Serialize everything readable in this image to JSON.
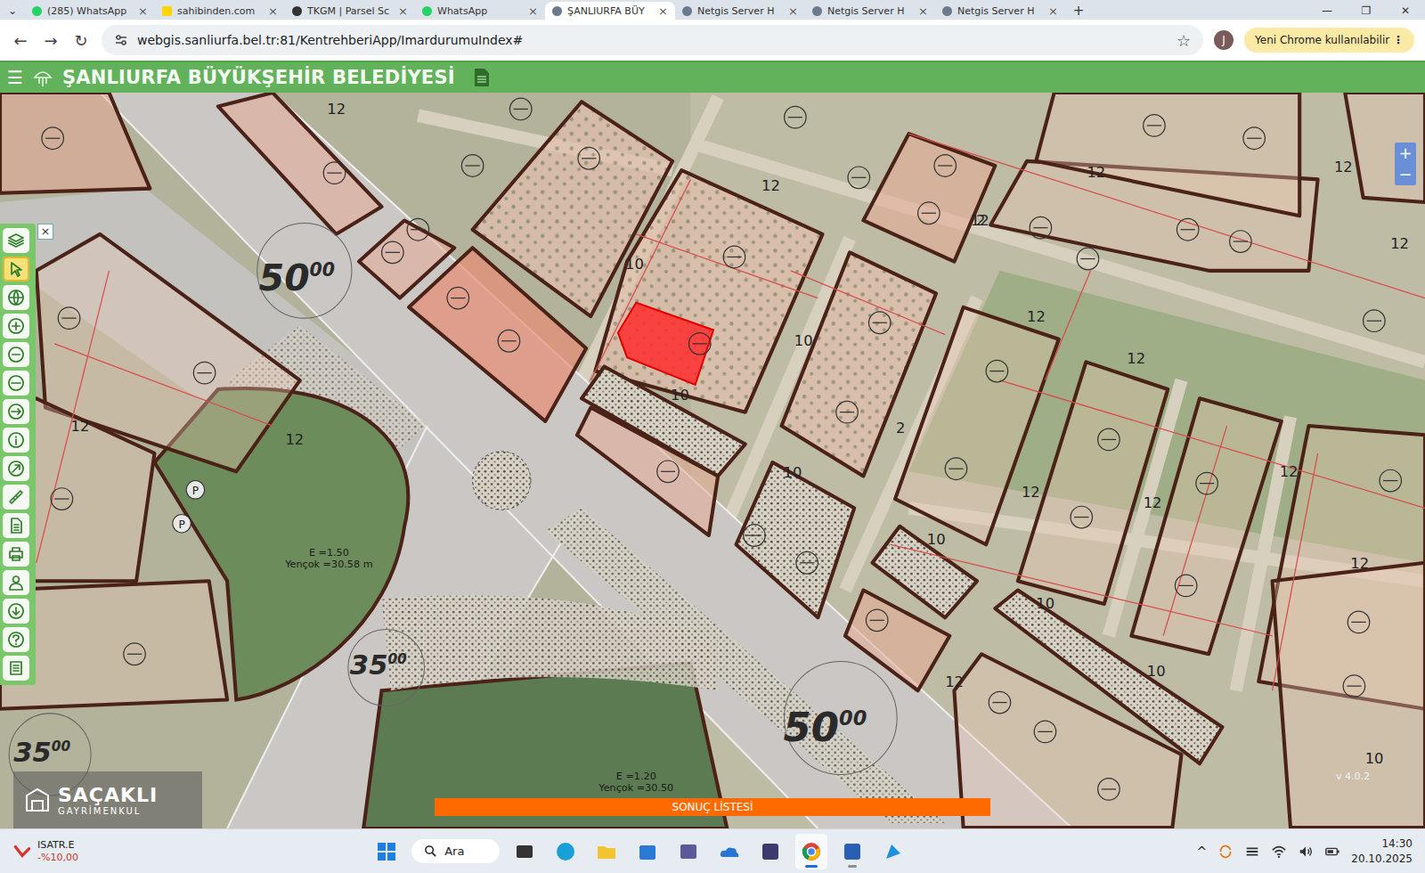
{
  "browser": {
    "tab_search": "⌄",
    "tabs": [
      {
        "label": "(285) WhatsApp",
        "selected": false
      },
      {
        "label": "sahibinden.com",
        "selected": false
      },
      {
        "label": "TKGM | Parsel Sc",
        "selected": false
      },
      {
        "label": "WhatsApp",
        "selected": false
      },
      {
        "label": "ŞANLIURFA BÜY",
        "selected": true
      },
      {
        "label": "Netgis Server H",
        "selected": false
      },
      {
        "label": "Netgis Server H",
        "selected": false
      },
      {
        "label": "Netgis Server H",
        "selected": false
      }
    ],
    "tab_close": "×",
    "new_tab": "+",
    "window_controls": [
      "—",
      "❐",
      "✕"
    ],
    "nav": [
      "←",
      "→",
      "↻"
    ],
    "url": "webgis.sanliurfa.bel.tr:81/KentrehberiApp/ImardurumuIndex#",
    "bookmark": "☆",
    "profile": "J",
    "update_button": "Yeni Chrome kullanılabilir",
    "menu": "⋮"
  },
  "app_header": {
    "menu": "☰",
    "title": "ŞANLIURFA BÜYÜKŞEHİR BELEDİYESİ"
  },
  "toolbar": {
    "close": "×",
    "tools": [
      {
        "selected": false
      },
      {
        "selected": true
      },
      {
        "selected": false
      },
      {
        "selected": false
      },
      {
        "selected": false
      },
      {
        "selected": false
      },
      {
        "selected": false
      },
      {
        "selected": false
      },
      {
        "selected": false
      },
      {
        "selected": false
      },
      {
        "selected": false
      },
      {
        "selected": false
      },
      {
        "selected": false
      },
      {
        "selected": false
      },
      {
        "selected": false
      },
      {
        "selected": false
      }
    ]
  },
  "zoom": [
    "+",
    "−"
  ],
  "map": {
    "selected_parcel": {
      "highlighted": true
    },
    "road_labels": [
      {
        "text": "50",
        "sup": "00"
      },
      {
        "text": "35",
        "sup": "00"
      },
      {
        "text": "50",
        "sup": "00"
      },
      {
        "text": "35",
        "sup": "00"
      }
    ],
    "dimension_labels": [
      "12",
      "12",
      "12",
      "12",
      "12",
      "12",
      "12",
      "12",
      "12",
      "12",
      "12",
      "12",
      "12",
      "12",
      "12",
      "10",
      "10",
      "10",
      "10",
      "10",
      "10",
      "10",
      "10",
      "2",
      "2"
    ],
    "area_notes": [
      [
        "E =1.50",
        "Yençok =30.58 m"
      ],
      [
        "E =1.20",
        "Yençok =30.50"
      ]
    ],
    "parking": [
      "P",
      "P"
    ],
    "version": "v 4.0.2"
  },
  "results_bar": "SONUÇ LİSTESİ",
  "watermark": {
    "name": "SAÇAKLI",
    "sub": "GAYRİMENKUL"
  },
  "taskbar": {
    "stock": {
      "symbol": "ISATR.E",
      "change": "-%10,00"
    },
    "search": "Ara",
    "apps": [
      {
        "running": false,
        "active": false
      },
      {
        "running": false,
        "active": false
      },
      {
        "running": false,
        "active": false
      },
      {
        "running": false,
        "active": false
      },
      {
        "running": false,
        "active": false
      },
      {
        "running": false,
        "active": false
      },
      {
        "running": false,
        "active": false
      },
      {
        "running": false,
        "active": false
      },
      {
        "running": true,
        "active": true
      },
      {
        "running": true,
        "active": false
      },
      {
        "running": false,
        "active": false
      }
    ],
    "tray_chevron": "^",
    "time": "14:30",
    "date": "20.10.2025"
  }
}
